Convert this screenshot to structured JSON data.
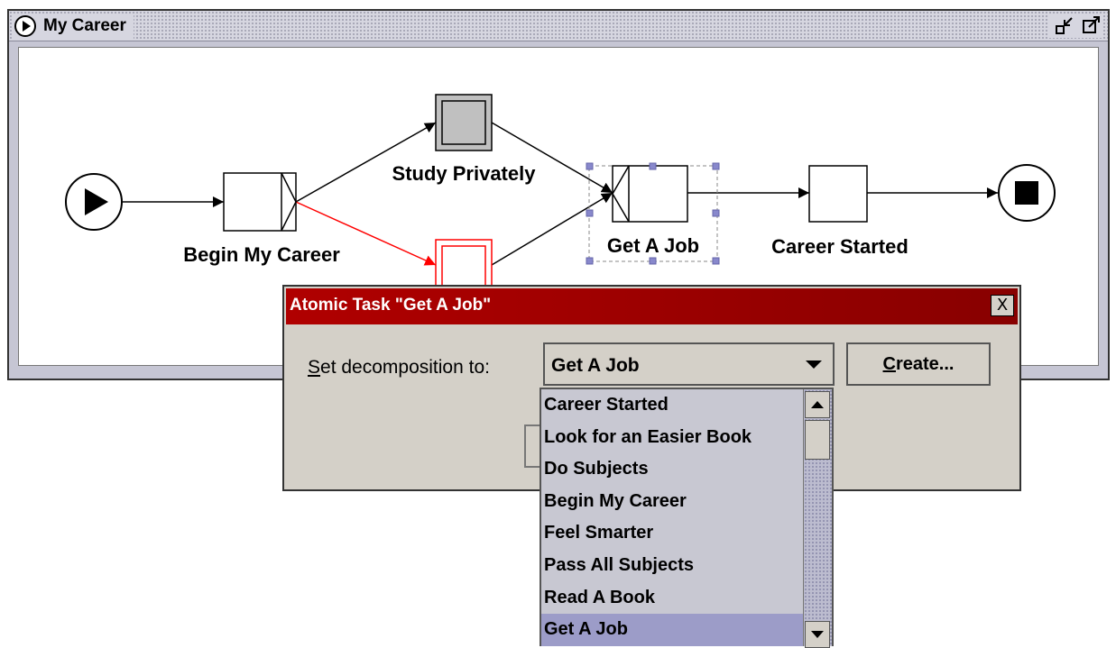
{
  "frame": {
    "title": "My Career",
    "minimize_icon": "iconify-icon",
    "maximize_icon": "maximize-icon"
  },
  "net": {
    "nodes": [
      {
        "id": "start",
        "kind": "input-condition",
        "label": ""
      },
      {
        "id": "begin",
        "kind": "atomic-task-xor-split",
        "label": "Begin My Career"
      },
      {
        "id": "study",
        "kind": "composite-task",
        "label": "Study Privately"
      },
      {
        "id": "other",
        "kind": "composite-task-selected-red",
        "label": ""
      },
      {
        "id": "getjob",
        "kind": "atomic-task-xor-join",
        "label": "Get A Job"
      },
      {
        "id": "career",
        "kind": "atomic-task",
        "label": "Career Started"
      },
      {
        "id": "end",
        "kind": "output-condition",
        "label": ""
      }
    ],
    "colors": {
      "highlight_flow": "#ff0000",
      "selection_handle": "#8888cc"
    }
  },
  "dialog": {
    "title": "Atomic Task \"Get A Job\"",
    "close_label": "X",
    "label_mnemonic": "S",
    "label_rest": "et decomposition to:",
    "combo_value": "Get A Job",
    "create_mnemonic": "C",
    "create_rest": "reate..."
  },
  "dropdown": {
    "items": [
      "Career Started",
      "Look for an Easier Book",
      "Do Subjects",
      "Begin My Career",
      "Feel Smarter",
      "Pass All Subjects",
      "Read A Book",
      "Get A Job"
    ],
    "selected": "Get A Job"
  }
}
